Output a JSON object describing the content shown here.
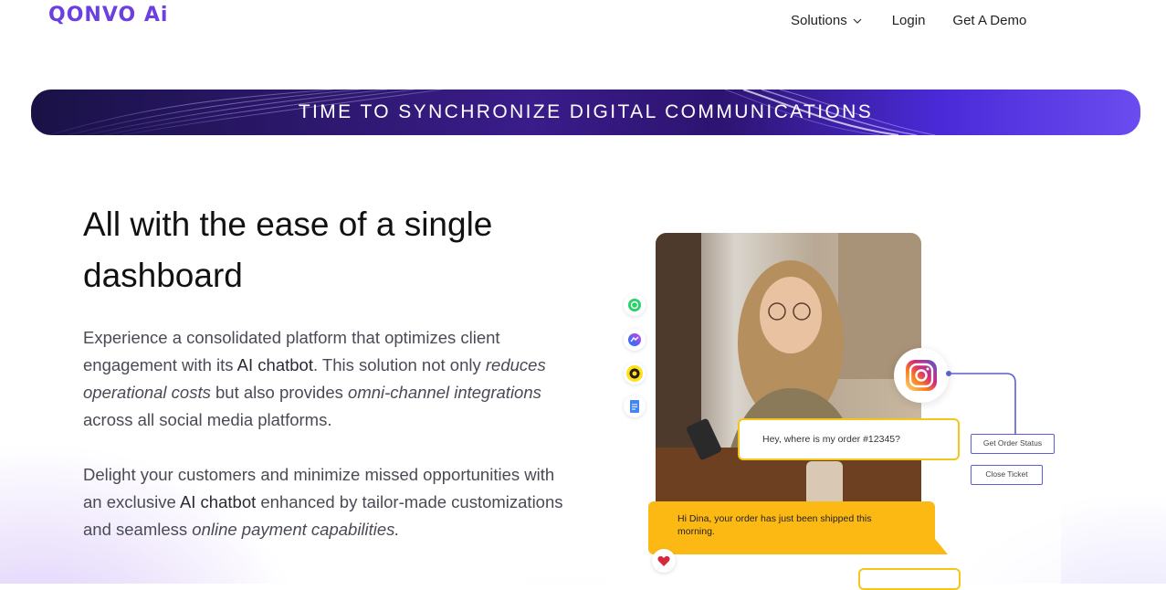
{
  "header": {
    "logo_text": "QONVO Ai",
    "nav": {
      "solutions": "Solutions",
      "login": "Login",
      "demo": "Get A Demo"
    }
  },
  "banner": {
    "text": "TIME TO SYNCHRONIZE DIGITAL COMMUNICATIONS"
  },
  "hero": {
    "heading": "All with the ease of a single dashboard",
    "para1": {
      "t1": "Experience a consolidated platform that optimizes client engagement with its ",
      "b1": "AI chatbot",
      "t2": ". This solution not only ",
      "i1": "reduces operational costs",
      "t3": " but also provides ",
      "i2": "omni-channel integrations",
      "t4": " across all social media platforms."
    },
    "para2": {
      "t1": "Delight your customers and minimize missed opportunities with an exclusive ",
      "b1": "AI chatbot",
      "t2": " enhanced by tailor-made customizations and seamless ",
      "i1": "online payment capabilities."
    }
  },
  "visual": {
    "channel_icons": [
      "whatsapp-icon",
      "messenger-icon",
      "mailchimp-icon",
      "google-docs-icon"
    ],
    "customer_message": "Hey, where is my order #12345?",
    "bot_reply": "Hi Dina, your order has just been shipped this morning.",
    "action_buttons": {
      "order_status": "Get Order Status",
      "close_ticket": "Close Ticket"
    }
  },
  "colors": {
    "brand": "#6b3fe0",
    "accent_yellow": "#fdb913",
    "button_border": "#5b5fd1"
  }
}
